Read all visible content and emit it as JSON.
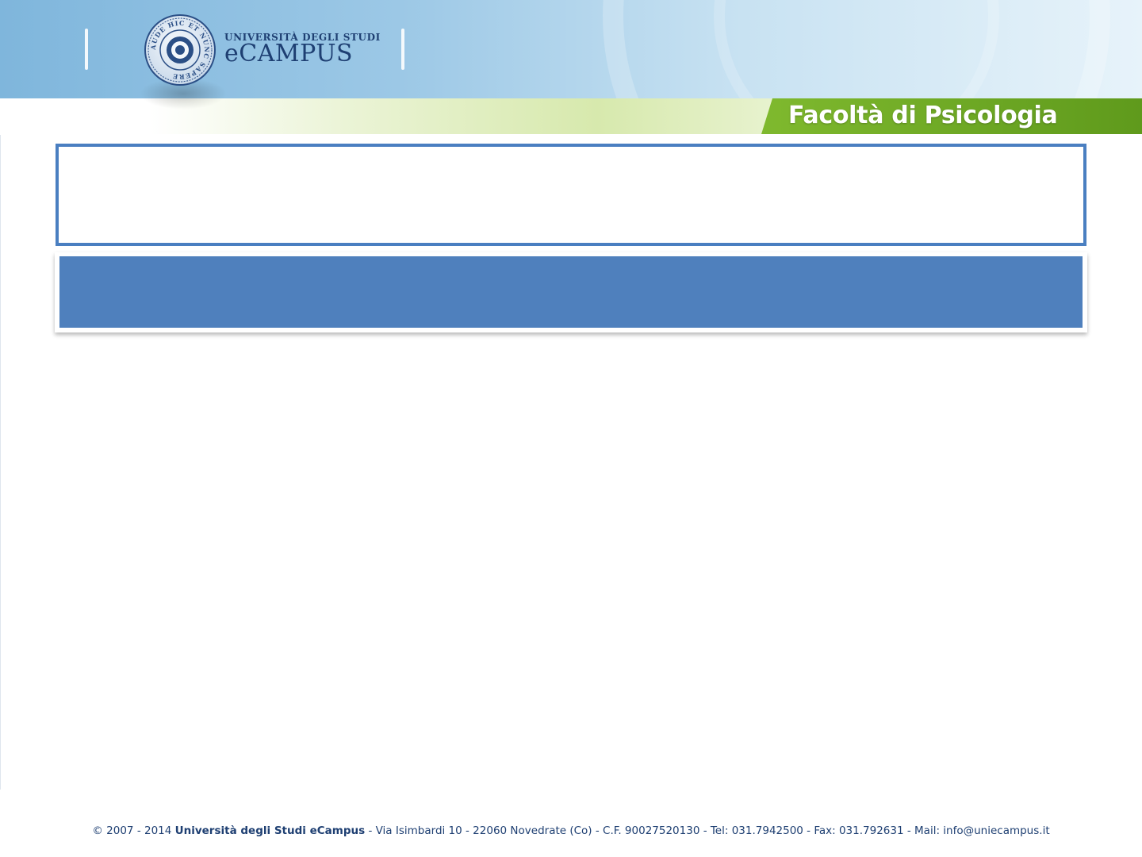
{
  "header": {
    "brand_top": "UNIVERSITÀ DEGLI STUDI",
    "brand_name": "eCAMPUS",
    "seal_text": "AUDE HIC ET NUNC SAPERE",
    "faculty": "Facoltà di Psicologia",
    "colors": {
      "band": "#9cc8e6",
      "brand_text": "#1e3f72",
      "faculty_tab": "#6aa924"
    }
  },
  "title_box": {
    "text": "",
    "border_color": "#4a7fc1"
  },
  "subtitle_box": {
    "text": "",
    "fill_color": "#4f80bd"
  },
  "footer": {
    "copyright": "© 2007 - 2014",
    "university": "Università degli Studi eCampus",
    "address": "- Via Isimbardi 10 - 22060 Novedrate (Co) - C.F. 90027520130 - Tel: 031.7942500 - Fax: 031.792631   - Mail: info@uniecampus.it"
  }
}
